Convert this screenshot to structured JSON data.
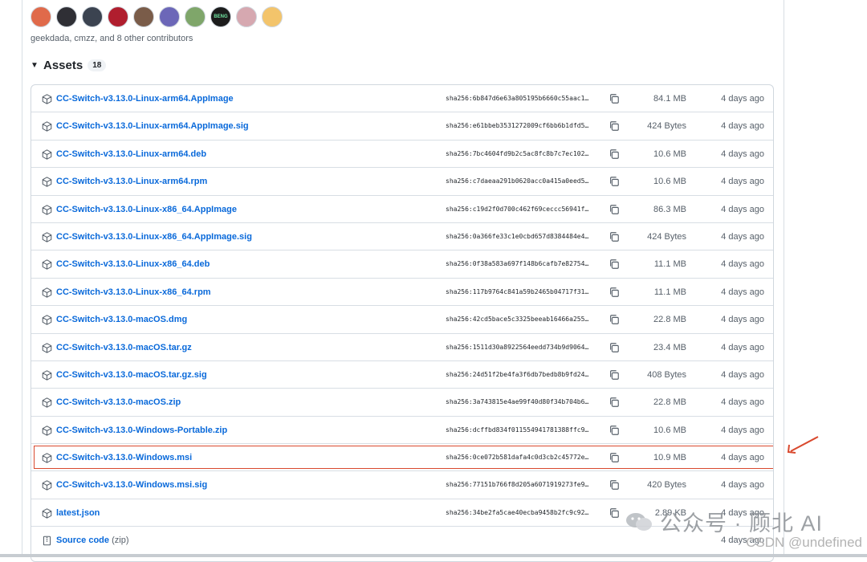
{
  "contributors": {
    "avatars": [
      {
        "color": "#e06a4a"
      },
      {
        "color": "#2f2f35"
      },
      {
        "color": "#3b4350"
      },
      {
        "color": "#b01e2e"
      },
      {
        "color": "#7a5c49"
      },
      {
        "color": "#6c67b8"
      },
      {
        "color": "#7fa66a"
      },
      {
        "label": "BENG",
        "color": "#1c1c1c"
      },
      {
        "color": "#d6a8b0"
      },
      {
        "color": "#f3c46b"
      }
    ],
    "text": "geekdada, cmzz, and 8 other contributors"
  },
  "assets": {
    "title": "Assets",
    "count": "18",
    "items": [
      {
        "name": "CC-Switch-v3.13.0-Linux-arm64.AppImage",
        "sha": "sha256:6b847d6e63a805195b6660c55aac1…",
        "size": "84.1 MB",
        "date": "4 days ago"
      },
      {
        "name": "CC-Switch-v3.13.0-Linux-arm64.AppImage.sig",
        "sha": "sha256:e61bbeb3531272009cf6bb6b1dfd5…",
        "size": "424 Bytes",
        "date": "4 days ago"
      },
      {
        "name": "CC-Switch-v3.13.0-Linux-arm64.deb",
        "sha": "sha256:7bc4604fd9b2c5ac8fc8b7c7ec102…",
        "size": "10.6 MB",
        "date": "4 days ago"
      },
      {
        "name": "CC-Switch-v3.13.0-Linux-arm64.rpm",
        "sha": "sha256:c7daeaa291b0620acc0a415a0eed5…",
        "size": "10.6 MB",
        "date": "4 days ago"
      },
      {
        "name": "CC-Switch-v3.13.0-Linux-x86_64.AppImage",
        "sha": "sha256:c19d2f0d700c462f69ceccc56941f…",
        "size": "86.3 MB",
        "date": "4 days ago"
      },
      {
        "name": "CC-Switch-v3.13.0-Linux-x86_64.AppImage.sig",
        "sha": "sha256:0a366fe33c1e0cbd657d8384484e4…",
        "size": "424 Bytes",
        "date": "4 days ago"
      },
      {
        "name": "CC-Switch-v3.13.0-Linux-x86_64.deb",
        "sha": "sha256:0f38a583a697f148b6cafb7e82754…",
        "size": "11.1 MB",
        "date": "4 days ago"
      },
      {
        "name": "CC-Switch-v3.13.0-Linux-x86_64.rpm",
        "sha": "sha256:117b9764c841a59b2465b04717f31…",
        "size": "11.1 MB",
        "date": "4 days ago"
      },
      {
        "name": "CC-Switch-v3.13.0-macOS.dmg",
        "sha": "sha256:42cd5bace5c3325beeab16466a255…",
        "size": "22.8 MB",
        "date": "4 days ago"
      },
      {
        "name": "CC-Switch-v3.13.0-macOS.tar.gz",
        "sha": "sha256:1511d30a8922564eedd734b9d9064…",
        "size": "23.4 MB",
        "date": "4 days ago"
      },
      {
        "name": "CC-Switch-v3.13.0-macOS.tar.gz.sig",
        "sha": "sha256:24d51f2be4fa3f6db7bedb8b9fd24…",
        "size": "408 Bytes",
        "date": "4 days ago"
      },
      {
        "name": "CC-Switch-v3.13.0-macOS.zip",
        "sha": "sha256:3a743815e4ae99f40d80f34b704b6…",
        "size": "22.8 MB",
        "date": "4 days ago"
      },
      {
        "name": "CC-Switch-v3.13.0-Windows-Portable.zip",
        "sha": "sha256:dcffbd834f011554941781388ffc9…",
        "size": "10.6 MB",
        "date": "4 days ago"
      },
      {
        "name": "CC-Switch-v3.13.0-Windows.msi",
        "sha": "sha256:0ce072b581dafa4c0d3cb2c45772e…",
        "size": "10.9 MB",
        "date": "4 days ago",
        "highlighted": true
      },
      {
        "name": "CC-Switch-v3.13.0-Windows.msi.sig",
        "sha": "sha256:77151b766f8d205a6071919273fe9…",
        "size": "420 Bytes",
        "date": "4 days ago"
      },
      {
        "name": "latest.json",
        "sha": "sha256:34be2fa5cae40ecba9458b2fc9c92…",
        "size": "2.89 KB",
        "date": "4 days ago"
      },
      {
        "name": "Source code",
        "suffix": "(zip)",
        "sha": "",
        "size": "",
        "date": "4 days ago",
        "source": true
      }
    ]
  },
  "watermark": {
    "text": "公众号 · 顾北 AI",
    "csdn": "CSDN @undefined"
  },
  "colors": {
    "link": "#0969da",
    "highlight": "#d9492e",
    "arrow": "#d9492e"
  }
}
